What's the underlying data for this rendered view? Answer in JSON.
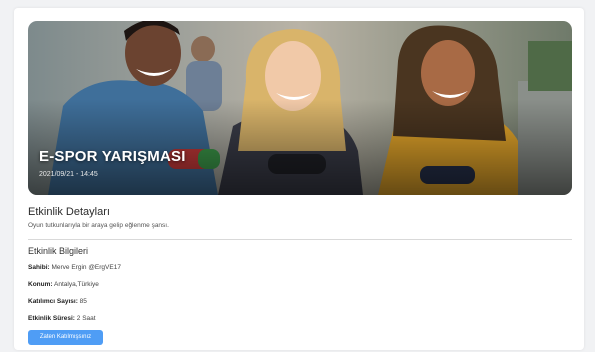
{
  "event": {
    "title": "E-SPOR YARIŞMASI",
    "datetime": "2021/09/21 - 14:45",
    "banner_image": "people-playing-video-games-photo"
  },
  "details": {
    "heading": "Etkinlik Detayları",
    "description": "Oyun tutkunlarıyla bir araya gelip eğlenme şansı."
  },
  "info": {
    "heading": "Etkinlik Bilgileri",
    "owner_label": "Sahibi:",
    "owner_value": "Merve Ergin @ErgVE17",
    "location_label": "Konum:",
    "location_value": "Antalya,Türkiye",
    "participants_label": "Katılımcı Sayısı:",
    "participants_value": "85",
    "duration_label": "Etkinlik Süresi:",
    "duration_value": "2 Saat"
  },
  "actions": {
    "joined_label": "Zaten Katılmışsınız"
  },
  "colors": {
    "accent": "#4f9df5",
    "background": "#f1f2f4"
  }
}
